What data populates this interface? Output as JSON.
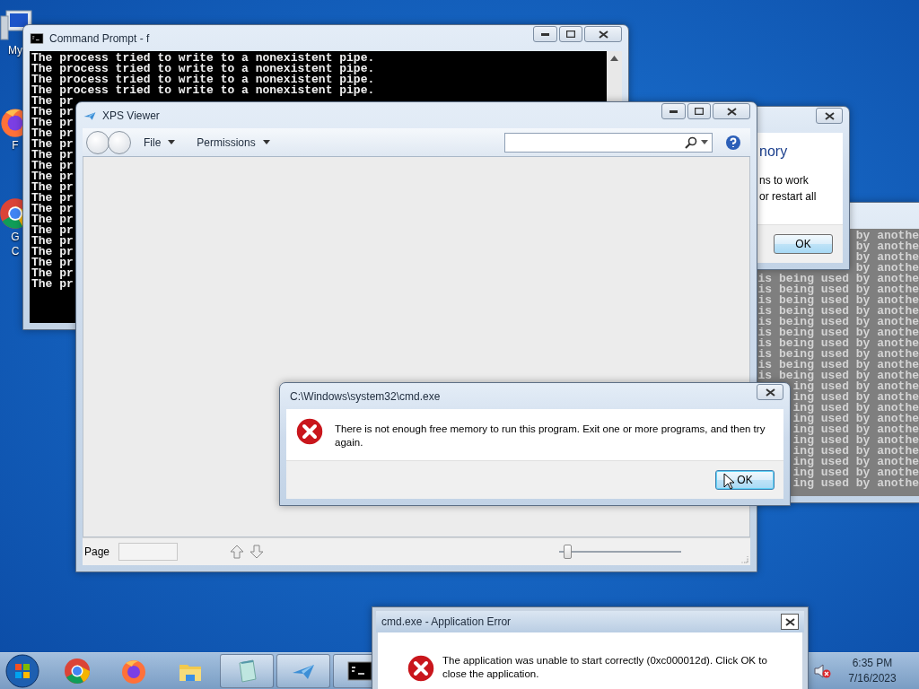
{
  "desktop_icons": [
    {
      "kind": "computer",
      "label_lines": [
        "My"
      ]
    },
    {
      "kind": "firefox",
      "label_lines": [
        "F"
      ]
    },
    {
      "kind": "chrome",
      "label_lines": [
        "G",
        "C"
      ]
    }
  ],
  "console_window": {
    "title": "Command Prompt - f",
    "lines": [
      "The process tried to write to a nonexistent pipe.",
      "The process tried to write to a nonexistent pipe.",
      "The process tried to write to a nonexistent pipe.",
      "The process tried to write to a nonexistent pipe.",
      "The pr",
      "The pr",
      "The pr",
      "The pr",
      "The pr",
      "The pr",
      "The pr",
      "The pr",
      "The pr",
      "The pr",
      "The pr",
      "The pr",
      "The pr",
      "The pr",
      "The pr",
      "The pr",
      "The pr",
      "The pr"
    ]
  },
  "background_console": {
    "lines": [
      "by anothe",
      "by anothe",
      "by anothe",
      "by anothe",
      "is being used by anothe",
      "is being used by anothe",
      "is being used by anothe",
      "is being used by anothe",
      "is being used by anothe",
      "is being used by anothe",
      "is being used by anothe",
      "is being used by anothe",
      "is being used by anothe",
      "is being used by anothe",
      "ing used by anothe",
      "ing used by anothe",
      "ing used by anothe",
      "ing used by anothe",
      "ing used by anothe",
      "ing used by anothe",
      "ing used by anothe",
      "ing used by anothe",
      "ing used by anothe",
      "ing used by anothe"
    ]
  },
  "background_dialog": {
    "heading": "nory",
    "body_lines": [
      "ns to work",
      "or restart all"
    ],
    "button": "OK"
  },
  "xps_viewer": {
    "title": "XPS Viewer",
    "menus": [
      "File",
      "Permissions"
    ],
    "page_label": "Page",
    "zoom": {
      "level": 0.04
    }
  },
  "error_dialog": {
    "title": "C:\\Windows\\system32\\cmd.exe",
    "message": "There is not enough free memory to run this program. Exit one or more programs, and then try again.",
    "button": "OK"
  },
  "app_error_dialog": {
    "title": "cmd.exe - Application Error",
    "message": "The application was unable to start correctly (0xc000012d). Click OK to close the application."
  },
  "taskbar": {
    "items": [
      {
        "kind": "chrome",
        "running": false
      },
      {
        "kind": "firefox",
        "running": false
      },
      {
        "kind": "explorer",
        "running": false
      },
      {
        "kind": "notepad",
        "running": true
      },
      {
        "kind": "xps",
        "running": true
      },
      {
        "kind": "cmd",
        "running": true
      }
    ],
    "clock": {
      "time": "6:35 PM",
      "date": "7/16/2023"
    }
  }
}
